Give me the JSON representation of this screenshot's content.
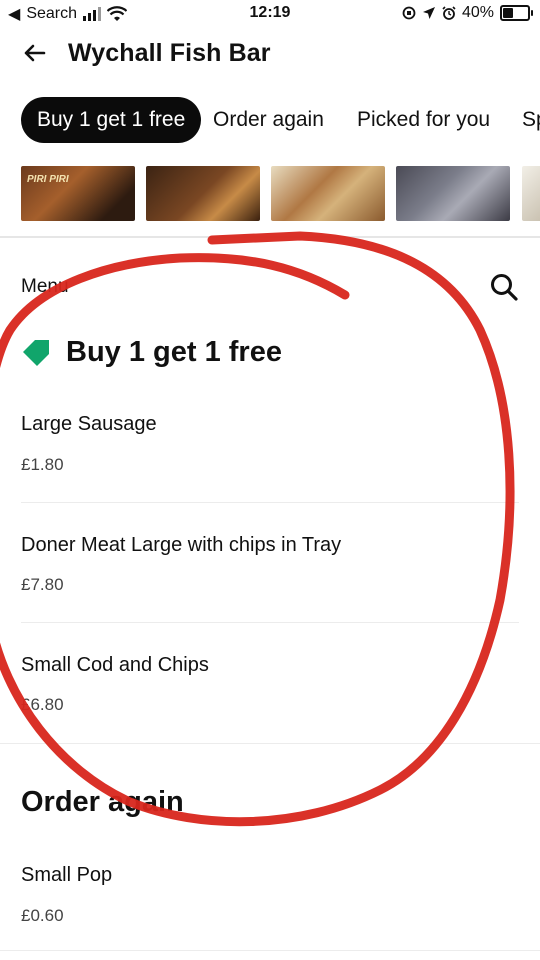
{
  "status_bar": {
    "back_app": "Search",
    "time": "12:19",
    "battery": "40%"
  },
  "header": {
    "title": "Wychall Fish Bar"
  },
  "chips": [
    {
      "label": "Buy 1 get 1 free"
    },
    {
      "label": "Order again"
    },
    {
      "label": "Picked for you"
    },
    {
      "label": "Sp"
    }
  ],
  "thumbnails": [
    {
      "caption": "PIRI PIRI"
    },
    {
      "caption": ""
    },
    {
      "caption": ""
    },
    {
      "caption": ""
    },
    {
      "caption": ""
    }
  ],
  "menu": {
    "label": "Menu"
  },
  "sections": [
    {
      "title": "Buy 1 get 1 free",
      "items": [
        {
          "name": "Large Sausage",
          "price": "£1.80"
        },
        {
          "name": "Doner Meat Large with chips in Tray",
          "price": "£7.80"
        },
        {
          "name": "Small Cod and Chips",
          "price": "£6.80"
        }
      ]
    },
    {
      "title": "Order again",
      "items": [
        {
          "name": "Small Pop",
          "price": "£0.60"
        }
      ]
    }
  ],
  "colors": {
    "tag_green": "#11a56b",
    "annotation_red": "#d8261c",
    "chip_active_bg": "#0b0b0b"
  }
}
